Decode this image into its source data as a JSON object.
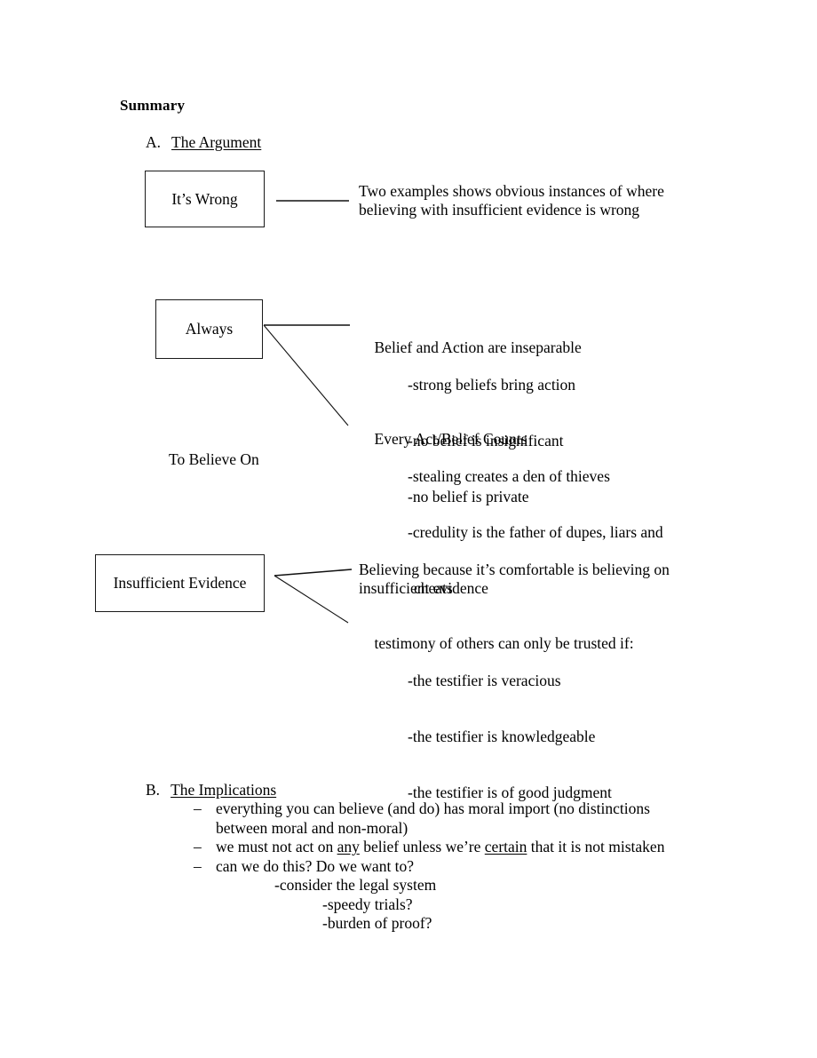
{
  "document": {
    "heading": "Summary"
  },
  "sections": {
    "a": {
      "letter": "A.",
      "title": "The Argument",
      "boxes": {
        "its_wrong": "It’s Wrong",
        "always": "Always",
        "insufficient_evidence": "Insufficient Evidence"
      },
      "standalone_label": "To Believe On",
      "annotations": {
        "its_wrong": "Two examples shows obvious instances of where\nbelieving with insufficient evidence is wrong",
        "belief_action_heading": "Belief and Action are inseparable",
        "belief_action_points": [
          "-strong beliefs bring action",
          "-no belief is insignificant",
          "-no belief is private"
        ],
        "every_act_heading": "Every Act/Belief Counts",
        "every_act_points": [
          "-stealing creates a den of thieves",
          "-credulity is the father of dupes, liars and",
          "cheats"
        ],
        "believing_comfortable": "Believing because it’s comfortable is believing on\ninsufficient evidence",
        "testimony_heading": "testimony of others can only be trusted if:",
        "testimony_points": [
          "-the testifier is veracious",
          "-the testifier is knowledgeable",
          "-the testifier is of good judgment"
        ]
      }
    },
    "b": {
      "letter": "B.",
      "title": "The Implications",
      "dash": "–",
      "items": [
        {
          "text_before": "everything you can believe (and do) has moral import (no distinctions between moral and non-moral)"
        },
        {
          "text_before": "we must not act on ",
          "emph1": "any",
          "text_mid": " belief unless we’re ",
          "emph2": "certain",
          "text_after": " that it is not mistaken"
        },
        {
          "text_before": "can we do this? Do we want to?",
          "sub_items": [
            "-consider the legal system",
            "-speedy trials?",
            "-burden of proof?"
          ]
        }
      ]
    }
  },
  "colors": {
    "ink": "#000000",
    "box_border": "#1a1a1a",
    "page_background": "#ffffff"
  }
}
